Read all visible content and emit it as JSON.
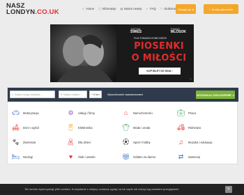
{
  "logo": {
    "line1": "NASZ",
    "line2a": "LONDYN",
    "line2b": ".CO.UK"
  },
  "nav": [
    {
      "label": "Home"
    },
    {
      "label": "Informacje"
    },
    {
      "label": "Nasze newsy"
    },
    {
      "label": "FAQ"
    },
    {
      "label": "Ulubione"
    }
  ],
  "header": {
    "login_label": "Zaloguj się",
    "add_label": "Dodaj ogłoszenie"
  },
  "banner": {
    "top_line": "KINO ŚWIATŁO · FILM TOMASZA KONECKIEGO",
    "name1": "SWIES",
    "name1_first": "JUSTYNA",
    "name2": "WLOSOK",
    "name2_first": "TOMASZ",
    "film_by": "FILM TOMASZA KONECKIEGO",
    "title_line1": "PIOSENKI",
    "title_line2": "O MIŁOŚCI",
    "buy_label": "KUP BILET DO KINA ›",
    "ad_mark": "▷"
  },
  "search": {
    "query_placeholder": "Wpisz czego szukasz...",
    "location_placeholder": "Wpisz miasto...",
    "radius_value": "+ 0 km",
    "advanced_label": "Wyszukiwanie zaawansowane",
    "button_label": "WYSZUKAJ OGŁOSZENIE"
  },
  "categories": [
    {
      "label": "Motoryzacja",
      "icon": "car-icon",
      "color": "#3a6fd0"
    },
    {
      "label": "Usługi i firmy",
      "icon": "gears-icon",
      "color": "#9b59b6"
    },
    {
      "label": "Nieruchomości",
      "icon": "house-icon",
      "color": "#e53935"
    },
    {
      "label": "Praca",
      "icon": "briefcase-icon",
      "color": "#2e9e4f"
    },
    {
      "label": "Dom i ogród",
      "icon": "sofa-icon",
      "color": "#e53935"
    },
    {
      "label": "Elektronika",
      "icon": "phone-icon",
      "color": "#f4a72a"
    },
    {
      "label": "Moda i uroda",
      "icon": "shirt-icon",
      "color": "#2e9e4f"
    },
    {
      "label": "Rolnictwo",
      "icon": "tractor-icon",
      "color": "#e53935"
    },
    {
      "label": "Zwierzęta",
      "icon": "paw-icon",
      "color": "#333333"
    },
    {
      "label": "Dla dzieci",
      "icon": "teddy-icon",
      "color": "#e53935"
    },
    {
      "label": "Sport i hobby",
      "icon": "ball-icon",
      "color": "#333333"
    },
    {
      "label": "Muzyka i edukacja",
      "icon": "music-icon",
      "color": "#e53935"
    },
    {
      "label": "Noclegi",
      "icon": "bed-icon",
      "color": "#3a6fd0"
    },
    {
      "label": "Ślub i wesele",
      "icon": "heart-icon",
      "color": "#e53935"
    },
    {
      "label": "Oddam za darmo",
      "icon": "gift-icon",
      "color": "#3a6fd0"
    },
    {
      "label": "Zamienię",
      "icon": "swap-icon",
      "color": "#3a6fd0"
    }
  ],
  "cookie": {
    "text": "Ten serwis wykorzystuje pliki cookies. Korzystanie z witryny oznacza zgodę na ich zapis lub odczyt wg ustawień przeglądarki.",
    "close_label": "×"
  },
  "colors": {
    "accent_orange": "#f4a72a",
    "search_green": "#7db23a",
    "search_bar": "#2f3b4c",
    "brand_red": "#e8262d"
  }
}
